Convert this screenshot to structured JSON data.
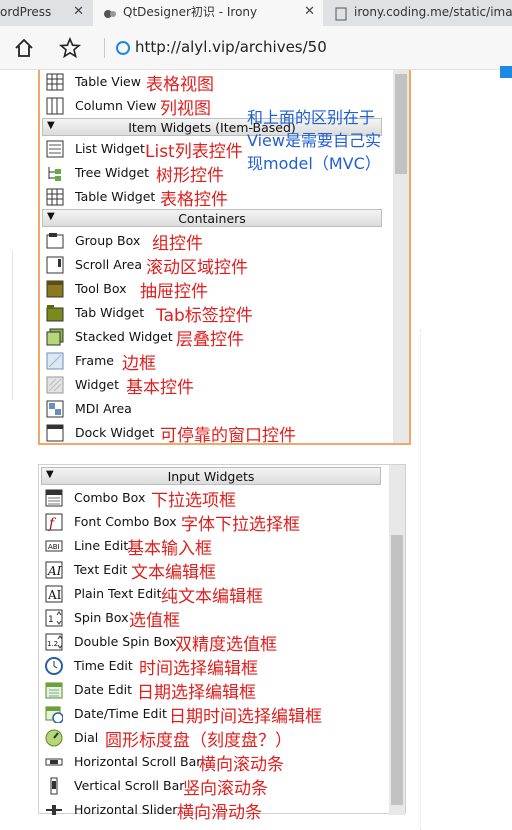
{
  "browser": {
    "tabs": [
      {
        "title": "ordPress"
      },
      {
        "title": "QtDesigner初识 - Irony"
      },
      {
        "title": "irony.coding.me/static/imag"
      }
    ],
    "address": "http://alyl.vip/archives/50"
  },
  "panel1": {
    "rows_top": [
      {
        "label": "Table View",
        "note": "表格视图"
      },
      {
        "label": "Column View",
        "note": "列视图"
      }
    ],
    "cat_item": "Item Widgets (Item-Based)",
    "rows_item": [
      {
        "label": "List Widget",
        "note": "List列表控件"
      },
      {
        "label": "Tree Widget",
        "note": "树形控件"
      },
      {
        "label": "Table Widget",
        "note": "表格控件"
      }
    ],
    "cat_containers": "Containers",
    "rows_containers": [
      {
        "label": "Group Box",
        "note": "组控件"
      },
      {
        "label": "Scroll Area",
        "note": "滚动区域控件"
      },
      {
        "label": "Tool Box",
        "note": "抽屉控件"
      },
      {
        "label": "Tab Widget",
        "note": "Tab标签控件"
      },
      {
        "label": "Stacked Widget",
        "note": "层叠控件"
      },
      {
        "label": "Frame",
        "note": "边框"
      },
      {
        "label": "Widget",
        "note": "基本控件"
      },
      {
        "label": "MDI Area",
        "note": ""
      },
      {
        "label": "Dock Widget",
        "note": "可停靠的窗口控件"
      }
    ],
    "blue_note": {
      "line1": "和上面的区别在于",
      "line2": "View是需要自己实",
      "line3": "现model（MVC）"
    }
  },
  "panel2": {
    "cat_input": "Input Widgets",
    "rows": [
      {
        "label": "Combo Box",
        "note": "下拉选项框"
      },
      {
        "label": "Font Combo Box",
        "note": "字体下拉选择框"
      },
      {
        "label": "Line Edit",
        "note": "基本输入框"
      },
      {
        "label": "Text Edit",
        "note": "文本编辑框"
      },
      {
        "label": "Plain Text Edit",
        "note": "纯文本编辑框"
      },
      {
        "label": "Spin Box",
        "note": "选值框"
      },
      {
        "label": "Double Spin Box",
        "note": "双精度选值框"
      },
      {
        "label": "Time Edit",
        "note": "时间选择编辑框"
      },
      {
        "label": "Date Edit",
        "note": "日期选择编辑框"
      },
      {
        "label": "Date/Time Edit",
        "note": "日期时间选择编辑框"
      },
      {
        "label": "Dial",
        "note": "圆形标度盘（刻度盘？）"
      },
      {
        "label": "Horizontal Scroll Bar",
        "note": "横向滚动条"
      },
      {
        "label": "Vertical Scroll Bar",
        "note": "竖向滚动条"
      },
      {
        "label": "Horizontal Slider",
        "note": "横向滑动条"
      }
    ]
  },
  "colors": {
    "annotation": "#e0201f",
    "note": "#1e5fd6",
    "highlight_border": "#f0a868"
  }
}
